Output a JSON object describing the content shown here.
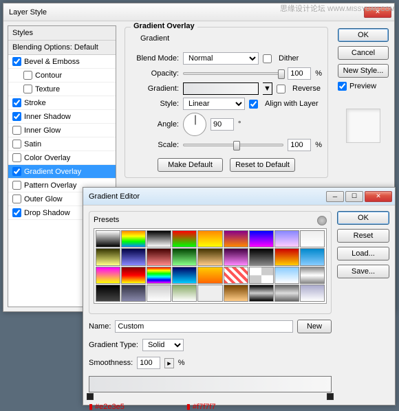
{
  "layerStyle": {
    "title": "Layer Style",
    "sidebar": {
      "styles": "Styles",
      "blending": "Blending Options: Default",
      "items": [
        {
          "label": "Bevel & Emboss",
          "checked": true,
          "sub": false
        },
        {
          "label": "Contour",
          "checked": false,
          "sub": true
        },
        {
          "label": "Texture",
          "checked": false,
          "sub": true
        },
        {
          "label": "Stroke",
          "checked": true,
          "sub": false
        },
        {
          "label": "Inner Shadow",
          "checked": true,
          "sub": false
        },
        {
          "label": "Inner Glow",
          "checked": false,
          "sub": false
        },
        {
          "label": "Satin",
          "checked": false,
          "sub": false
        },
        {
          "label": "Color Overlay",
          "checked": false,
          "sub": false
        },
        {
          "label": "Gradient Overlay",
          "checked": true,
          "sub": false,
          "selected": true
        },
        {
          "label": "Pattern Overlay",
          "checked": false,
          "sub": false
        },
        {
          "label": "Outer Glow",
          "checked": false,
          "sub": false
        },
        {
          "label": "Drop Shadow",
          "checked": true,
          "sub": false
        }
      ]
    },
    "panel": {
      "groupTitle": "Gradient Overlay",
      "subTitle": "Gradient",
      "blendModeLabel": "Blend Mode:",
      "blendMode": "Normal",
      "dither": "Dither",
      "opacityLabel": "Opacity:",
      "opacity": "100",
      "pct": "%",
      "gradientLabel": "Gradient:",
      "reverse": "Reverse",
      "styleLabel": "Style:",
      "style": "Linear",
      "align": "Align with Layer",
      "angleLabel": "Angle:",
      "angle": "90",
      "deg": "°",
      "scaleLabel": "Scale:",
      "scale": "100",
      "makeDefault": "Make Default",
      "resetDefault": "Reset to Default"
    },
    "buttons": {
      "ok": "OK",
      "cancel": "Cancel",
      "newStyle": "New Style...",
      "preview": "Preview"
    }
  },
  "gradientEditor": {
    "title": "Gradient Editor",
    "presets": "Presets",
    "ok": "OK",
    "reset": "Reset",
    "load": "Load...",
    "save": "Save...",
    "nameLabel": "Name:",
    "name": "Custom",
    "new": "New",
    "gradTypeLabel": "Gradient Type:",
    "gradType": "Solid",
    "smoothLabel": "Smoothness:",
    "smooth": "100",
    "pct": "%",
    "color1": "#e2e3e5",
    "color2": "#f7f7f7"
  },
  "presetColors": [
    "linear-gradient(#fff,#000)",
    "linear-gradient(#f80,#ff0,#0f0,#08f)",
    "linear-gradient(#000,#fff)",
    "linear-gradient(#f00,#0f0)",
    "linear-gradient(#f80,#ff0)",
    "linear-gradient(#808,#f80)",
    "linear-gradient(#00f,#f0f)",
    "linear-gradient(#88f,#fcf)",
    "linear-gradient(#eee,#fff)",
    "linear-gradient(#330,#ff8)",
    "linear-gradient(#004,#88f)",
    "linear-gradient(#400,#f88)",
    "linear-gradient(#040,#8f8)",
    "linear-gradient(#430,#fc8)",
    "linear-gradient(#404,#f8f)",
    "linear-gradient(#000,#888)",
    "linear-gradient(#c00,#fc0)",
    "linear-gradient(#08c,#8cf)",
    "linear-gradient(#f0f,#ff0)",
    "linear-gradient(#800,#f00,#ff0)",
    "linear-gradient(#f00,#ff0,#0f0,#0ff,#00f,#f0f)",
    "linear-gradient(#006,#0cf)",
    "linear-gradient(#fc0,#f60)",
    "repeating-linear-gradient(45deg,#f55,#f55 4px,#fff 4px,#fff 8px)",
    "repeating-conic-gradient(#ccc 0 25%,#fff 0 50%)",
    "linear-gradient(#8cf,#fff)",
    "linear-gradient(#888,#fff,#888)",
    "linear-gradient(#000,#444)",
    "linear-gradient(#334,#88a)",
    "linear-gradient(#ccc,#fff)",
    "linear-gradient(#8a6,#fff)",
    "linear-gradient(#eee,#eee)",
    "linear-gradient(#740,#fc8)",
    "linear-gradient(#000,#ccc,#000)",
    "linear-gradient(#666,#ddd,#666)",
    "linear-gradient(#aac,#fff)"
  ]
}
